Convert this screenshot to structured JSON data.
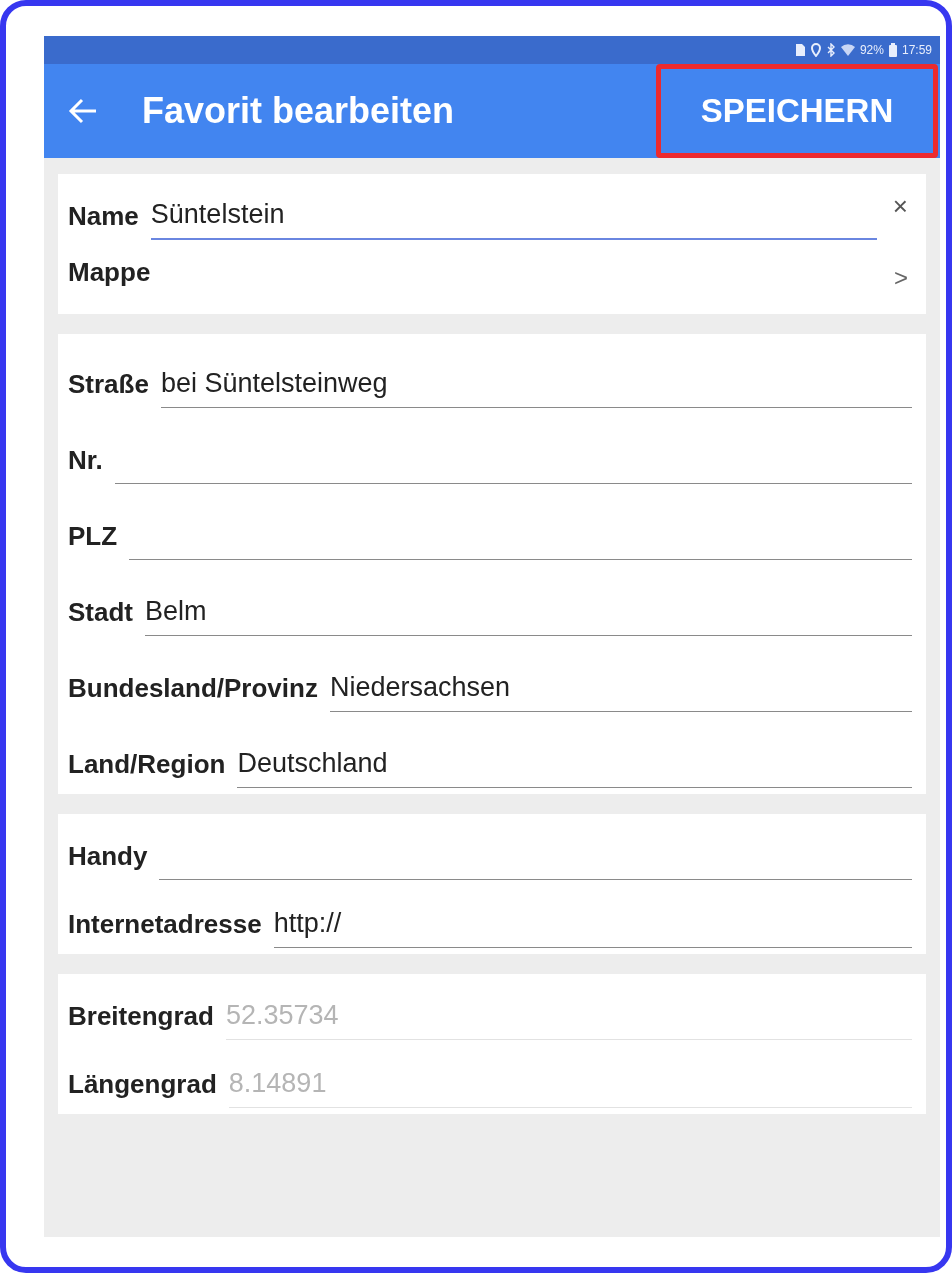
{
  "status_bar": {
    "battery": "92%",
    "time": "17:59"
  },
  "app_bar": {
    "title": "Favorit bearbeiten",
    "action": {
      "label": "SPEICHERN",
      "highlighted": true
    }
  },
  "sections": [
    {
      "fields": [
        {
          "kind": "input",
          "label": "Name",
          "value": "Süntelstein",
          "focused": true,
          "clear": "×",
          "disabled": false
        },
        {
          "kind": "link",
          "label": "Mappe",
          "chevron": ">"
        }
      ]
    },
    {
      "fields": [
        {
          "kind": "input",
          "label": "Straße",
          "value": "bei Süntelsteinweg",
          "focused": false,
          "disabled": false
        },
        {
          "kind": "input",
          "label": "Nr.",
          "focused": false,
          "disabled": false
        },
        {
          "kind": "input",
          "label": "PLZ",
          "focused": false,
          "disabled": false
        },
        {
          "kind": "input",
          "label": "Stadt",
          "value": "Belm",
          "focused": false,
          "disabled": false
        },
        {
          "kind": "input",
          "label": "Bundesland/Provinz",
          "value": "Niedersachsen",
          "focused": false,
          "disabled": false
        },
        {
          "kind": "input",
          "label": "Land/Region",
          "value": "Deutschland",
          "focused": false,
          "disabled": false
        }
      ]
    },
    {
      "fields": [
        {
          "kind": "input",
          "label": "Handy",
          "focused": false,
          "disabled": false
        },
        {
          "kind": "input",
          "label": "Internetadresse",
          "value": "http://",
          "focused": false,
          "disabled": false
        }
      ]
    },
    {
      "fields": [
        {
          "kind": "input",
          "label": "Breitengrad",
          "value": "52.35734",
          "focused": false,
          "disabled": true
        },
        {
          "kind": "input",
          "label": "Längengrad",
          "value": "8.14891",
          "focused": false,
          "disabled": true
        }
      ]
    }
  ]
}
